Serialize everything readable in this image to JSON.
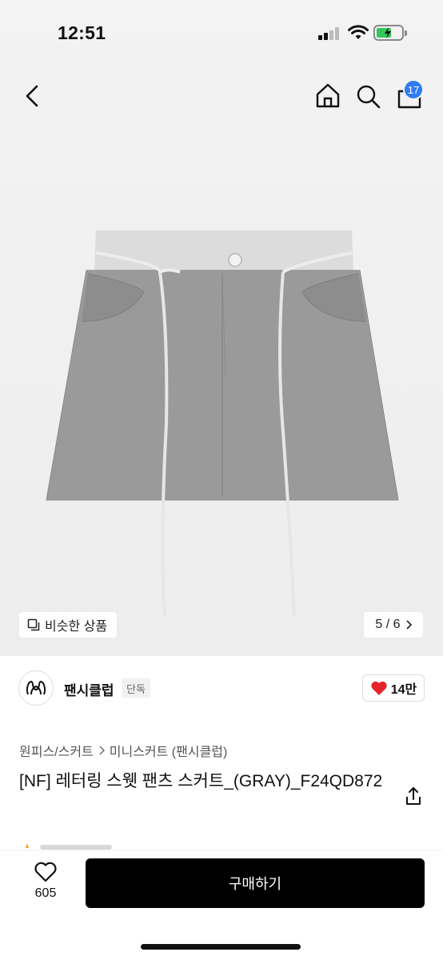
{
  "status_bar": {
    "time": "12:51"
  },
  "header": {
    "back_icon": "chevron-left-icon",
    "home_icon": "home-icon",
    "search_icon": "search-icon",
    "cart_icon": "shopping-bag-icon",
    "cart_count": "17"
  },
  "gallery": {
    "similar_label": "비슷한 상품",
    "page_indicator": "5 / 6"
  },
  "brand": {
    "name": "팬시클럽",
    "tag": "단독",
    "likes": "14만"
  },
  "breadcrumb": {
    "category": "원피스/스커트",
    "subcategory": "미니스커트 (팬시클럽)"
  },
  "product": {
    "title": "[NF] 레터링 스웻 팬츠 스커트_(GRAY)_F24QD872"
  },
  "bottom_bar": {
    "wish_count": "605",
    "buy_label": "구매하기"
  },
  "colors": {
    "accent": "#2f7cf6",
    "heart": "#e5242b",
    "buy_button": "#000000"
  }
}
